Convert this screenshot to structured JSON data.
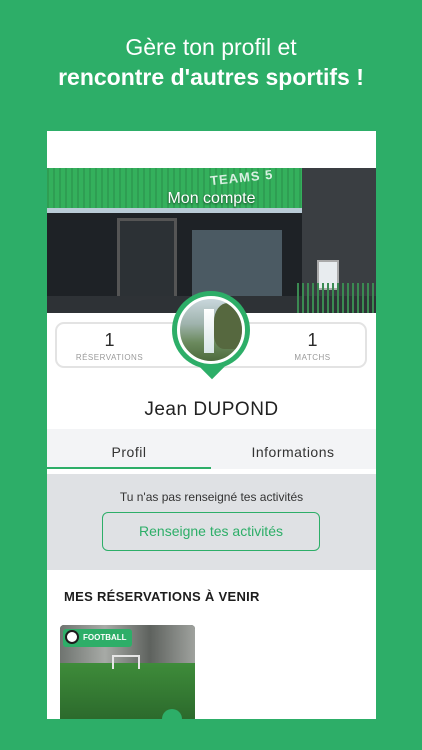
{
  "colors": {
    "brand_green": "#2dae68",
    "background": "#2dae68",
    "panel_grey": "#dfe1e4"
  },
  "headline": {
    "line1": "Gère ton profil et",
    "line2": "rencontre d'autres sportifs !"
  },
  "cover": {
    "title": "Mon compte",
    "sign_text": "TEAMS 5"
  },
  "stats": {
    "reservations": {
      "value": "1",
      "label": "RÉSERVATIONS"
    },
    "matches": {
      "value": "1",
      "label": "MATCHS"
    }
  },
  "profile": {
    "first_name": "Jean",
    "last_name": "DUPOND"
  },
  "tabs": [
    {
      "label": "Profil",
      "active": true
    },
    {
      "label": "Informations",
      "active": false
    }
  ],
  "activities": {
    "message": "Tu n'as pas renseigné tes activités",
    "button_label": "Renseigne tes activités"
  },
  "upcoming": {
    "title": "MES RÉSERVATIONS À VENIR",
    "cards": [
      {
        "badge": "FOOTBALL",
        "icon": "soccer-ball-icon"
      }
    ]
  }
}
